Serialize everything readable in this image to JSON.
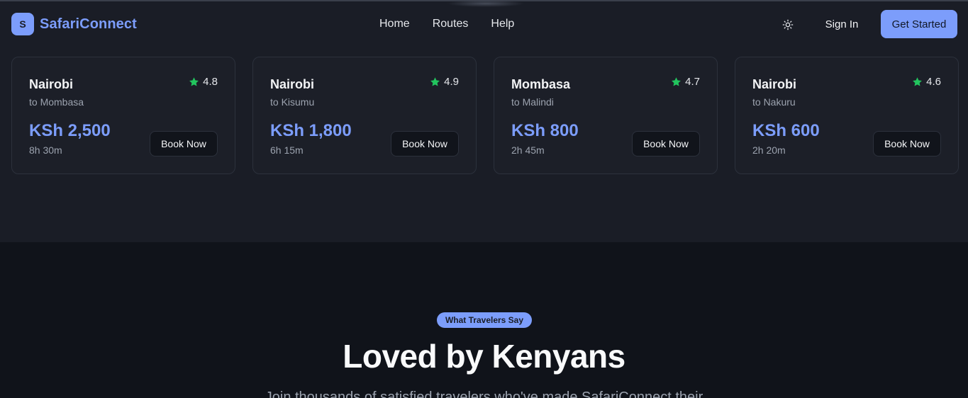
{
  "header": {
    "brand_initial": "S",
    "brand_name": "SafariConnect",
    "nav": [
      "Home",
      "Routes",
      "Help"
    ],
    "sign_in": "Sign In",
    "get_started": "Get Started",
    "theme_icon": "sun-icon"
  },
  "routes": [
    {
      "from": "Nairobi",
      "to": "to Mombasa",
      "rating": "4.8",
      "price": "KSh 2,500",
      "duration": "8h 30m",
      "cta": "Book Now"
    },
    {
      "from": "Nairobi",
      "to": "to Kisumu",
      "rating": "4.9",
      "price": "KSh 1,800",
      "duration": "6h 15m",
      "cta": "Book Now"
    },
    {
      "from": "Mombasa",
      "to": "to Malindi",
      "rating": "4.7",
      "price": "KSh 800",
      "duration": "2h 45m",
      "cta": "Book Now"
    },
    {
      "from": "Nairobi",
      "to": "to Nakuru",
      "rating": "4.6",
      "price": "KSh 600",
      "duration": "2h 20m",
      "cta": "Book Now"
    }
  ],
  "testimonials": {
    "badge": "What Travelers Say",
    "title": "Loved by Kenyans",
    "subtitle": "Join thousands of satisfied travelers who've made SafariConnect their"
  },
  "colors": {
    "accent": "#7c9dfb",
    "star": "#22c55e",
    "background": "#1a1d26",
    "section_bg": "#10131a"
  }
}
